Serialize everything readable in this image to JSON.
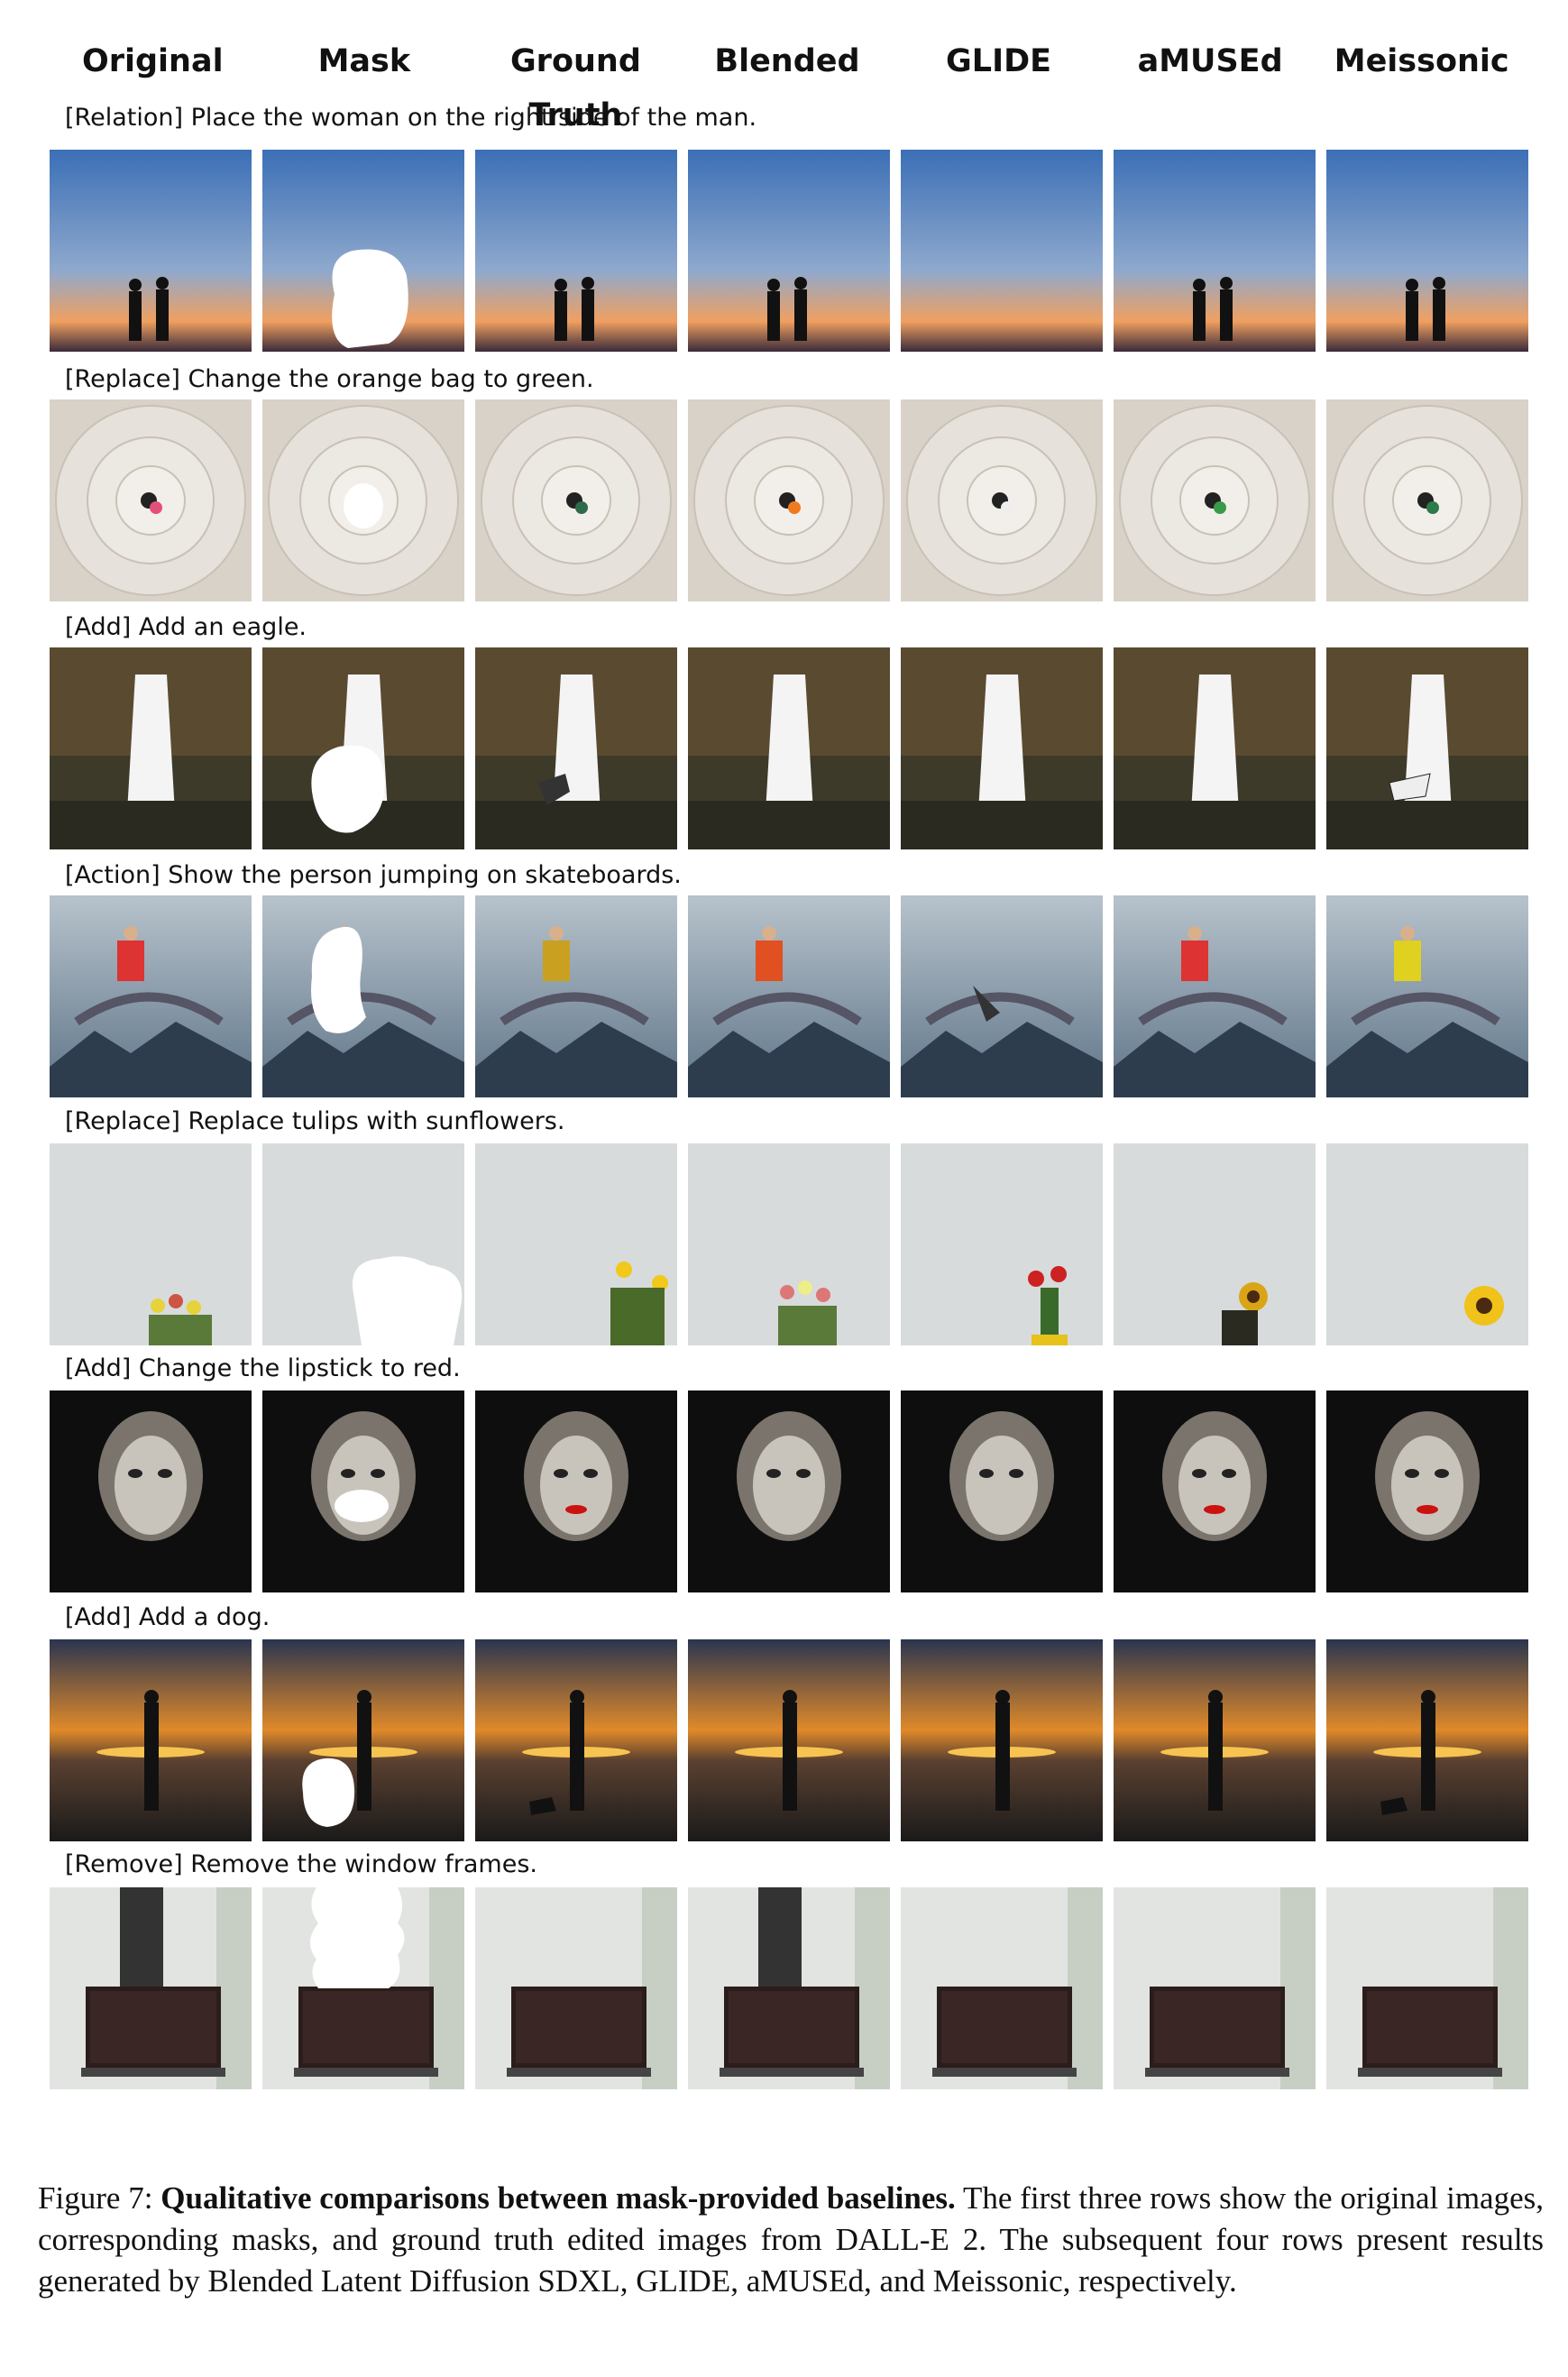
{
  "columns": [
    "Original",
    "Mask",
    "Ground Truth",
    "Blended",
    "GLIDE",
    "aMUSEd",
    "Meissonic"
  ],
  "rows": [
    {
      "instruction": "[Relation] Place the woman on the right side of the man.",
      "scene": "sunset-couple"
    },
    {
      "instruction": "[Replace] Change the orange bag to green.",
      "scene": "tiled-plaza"
    },
    {
      "instruction": "[Add] Add an eagle.",
      "scene": "waterfall"
    },
    {
      "instruction": "[Action] Show the person jumping on skateboards.",
      "scene": "skater-mountain"
    },
    {
      "instruction": "[Replace] Replace tulips with sunflowers.",
      "scene": "flowers-wall"
    },
    {
      "instruction": "[Add] Change the lipstick to red.",
      "scene": "mask-face"
    },
    {
      "instruction": "[Add] Add a dog.",
      "scene": "beach-sunset"
    },
    {
      "instruction": "[Remove] Remove the window frames.",
      "scene": "laptop-window"
    }
  ],
  "caption": {
    "label": "Figure 7: ",
    "title": "Qualitative comparisons between mask-provided baselines.",
    "body": " The first three rows show the original images, corresponding masks, and ground truth edited images from DALL-E 2. The subsequent four rows present results generated by Blended Latent Diffusion SDXL, GLIDE, aMUSEd, and Meissonic, respectively."
  }
}
